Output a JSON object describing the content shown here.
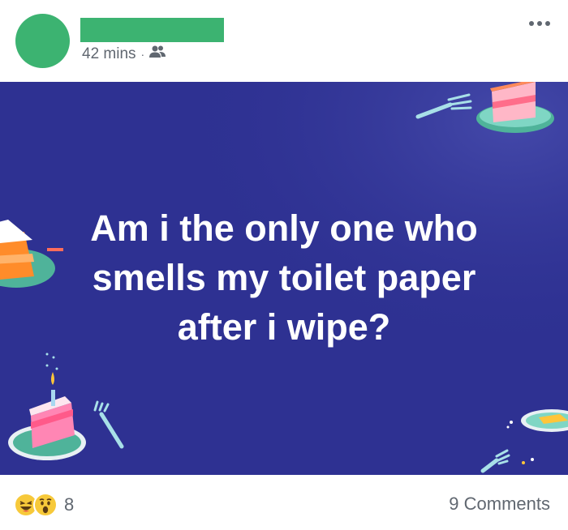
{
  "post": {
    "timestamp": "42 mins",
    "separator": "·",
    "audience_icon": "friends-icon",
    "text": "Am i the only one who\nsmells my toilet paper\nafter i wipe?",
    "background_color": "#2e3192",
    "text_color": "#ffffff"
  },
  "reactions": {
    "icons": [
      "laugh-reaction-icon",
      "wow-reaction-icon"
    ],
    "count": "8"
  },
  "comments_label": "9 Comments",
  "colors": {
    "avatar_redaction": "#3cb371",
    "meta_text": "#606770"
  }
}
